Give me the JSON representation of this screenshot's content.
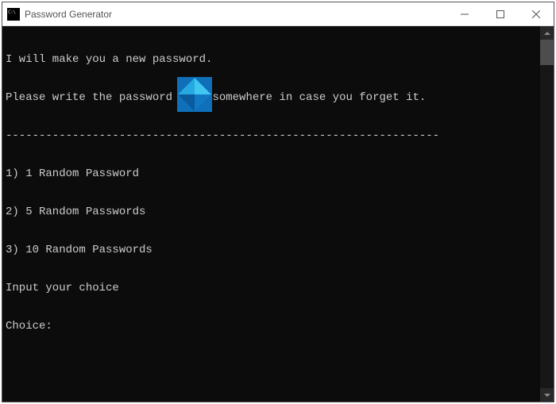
{
  "window": {
    "title": "Password Generator"
  },
  "console": {
    "lines": [
      "I will make you a new password.",
      "Please write the password down somewhere in case you forget it.",
      "-----------------------------------------------------------------",
      "1) 1 Random Password",
      "2) 5 Random Passwords",
      "3) 10 Random Passwords",
      "Input your choice",
      "Choice:"
    ]
  },
  "overlay": {
    "icon_name": "windows-club-logo"
  }
}
